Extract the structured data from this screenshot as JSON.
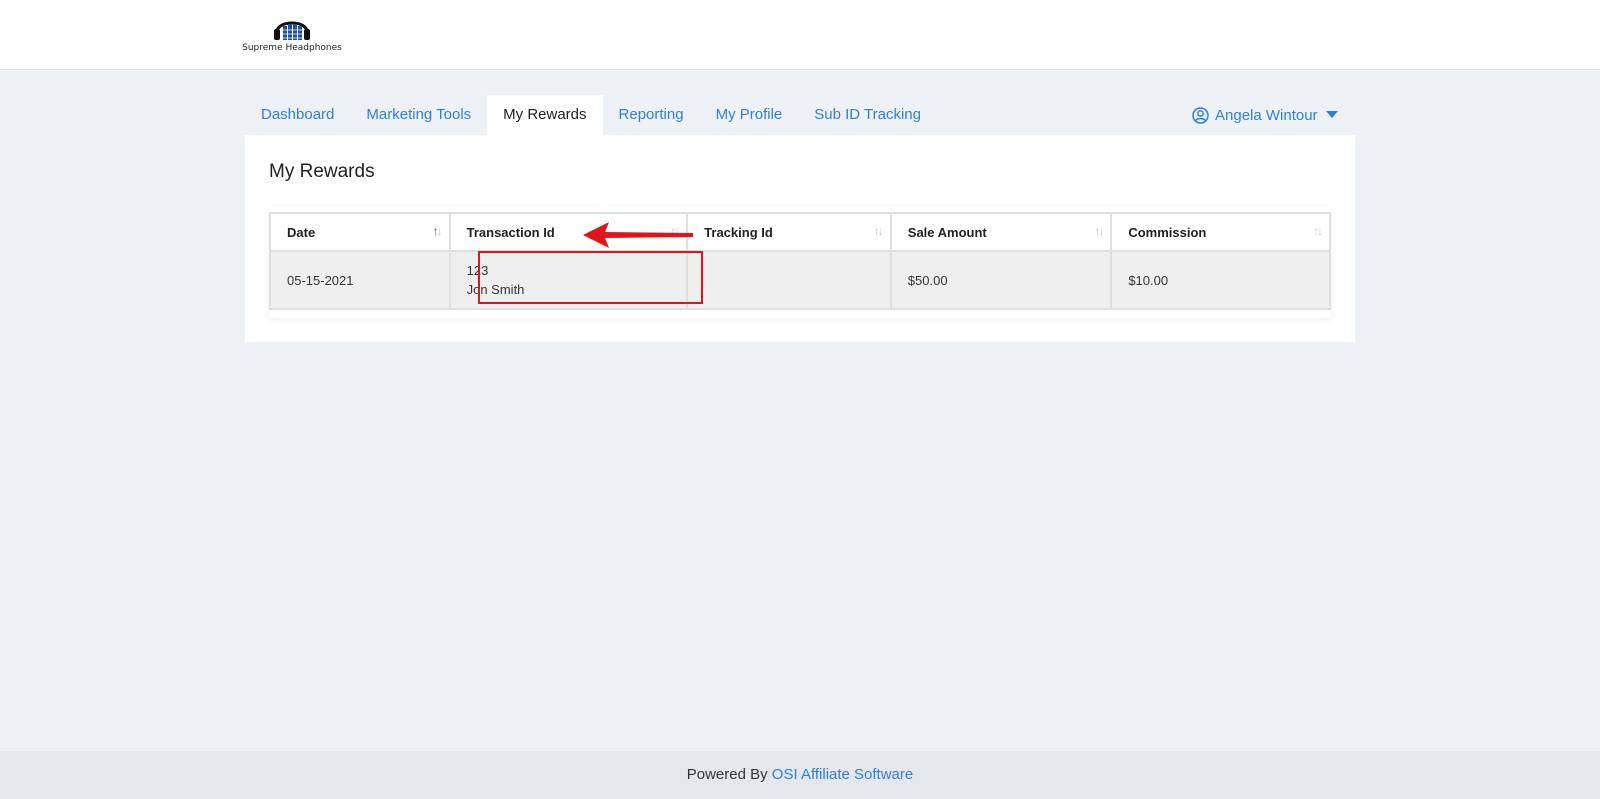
{
  "brand": {
    "logo_text": "Supreme Headphones",
    "logo_icon": "headphones-icon"
  },
  "nav": {
    "items": [
      {
        "label": "Dashboard",
        "active": false
      },
      {
        "label": "Marketing Tools",
        "active": false
      },
      {
        "label": "My Rewards",
        "active": true
      },
      {
        "label": "Reporting",
        "active": false
      },
      {
        "label": "My Profile",
        "active": false
      },
      {
        "label": "Sub ID Tracking",
        "active": false
      }
    ],
    "user_name": "Angela Wintour",
    "user_icon": "user-circle-icon",
    "caret_icon": "caret-down-icon"
  },
  "page": {
    "title": "My Rewards"
  },
  "table": {
    "columns": [
      "Date",
      "Transaction Id",
      "Tracking Id",
      "Sale Amount",
      "Commission"
    ],
    "rows": [
      {
        "date": "05-15-2021",
        "transaction_id": "123",
        "transaction_name": "Jon Smith",
        "tracking_id": "",
        "sale_amount": "$50.00",
        "commission": "$10.00"
      }
    ]
  },
  "annotation": {
    "color": "#e0151b",
    "arrow_icon": "arrow-left-icon"
  },
  "footer": {
    "prefix": "Powered By",
    "link": "OSI Affiliate Software"
  },
  "colors": {
    "accent": "#2f7fd8",
    "background": "#eef1f5"
  }
}
